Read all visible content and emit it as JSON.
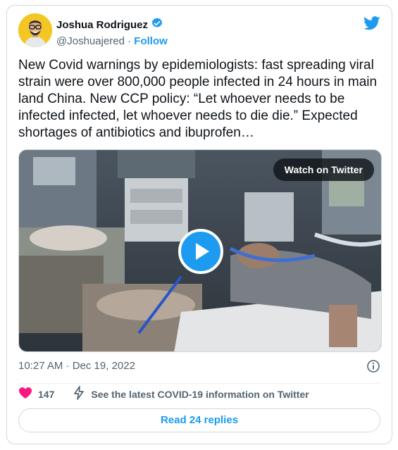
{
  "author": {
    "display_name": "Joshua Rodriguez",
    "handle": "@Joshuajered",
    "separator": "·",
    "follow_label": "Follow",
    "verified": true
  },
  "tweet": {
    "text": "New Covid warnings by epidemiologists: fast spreading viral strain were over 800,000 people infected in 24 hours in main land China. New CCP policy: “Let whoever needs to be infected infected, let whoever needs to die die.” Expected shortages of antibiotics and ibuprofen…",
    "timestamp": "10:27 AM · Dec 19, 2022"
  },
  "media": {
    "watch_label": "Watch on Twitter",
    "play_icon": "play-icon"
  },
  "actions": {
    "like_count": "147",
    "covid_info_label": "See the latest COVID-19 information on Twitter"
  },
  "replies_button": "Read 24 replies",
  "colors": {
    "brand_blue": "#1d9bf0",
    "like_pink": "#f91880",
    "muted_text": "#536471",
    "border": "#cfd9de"
  }
}
